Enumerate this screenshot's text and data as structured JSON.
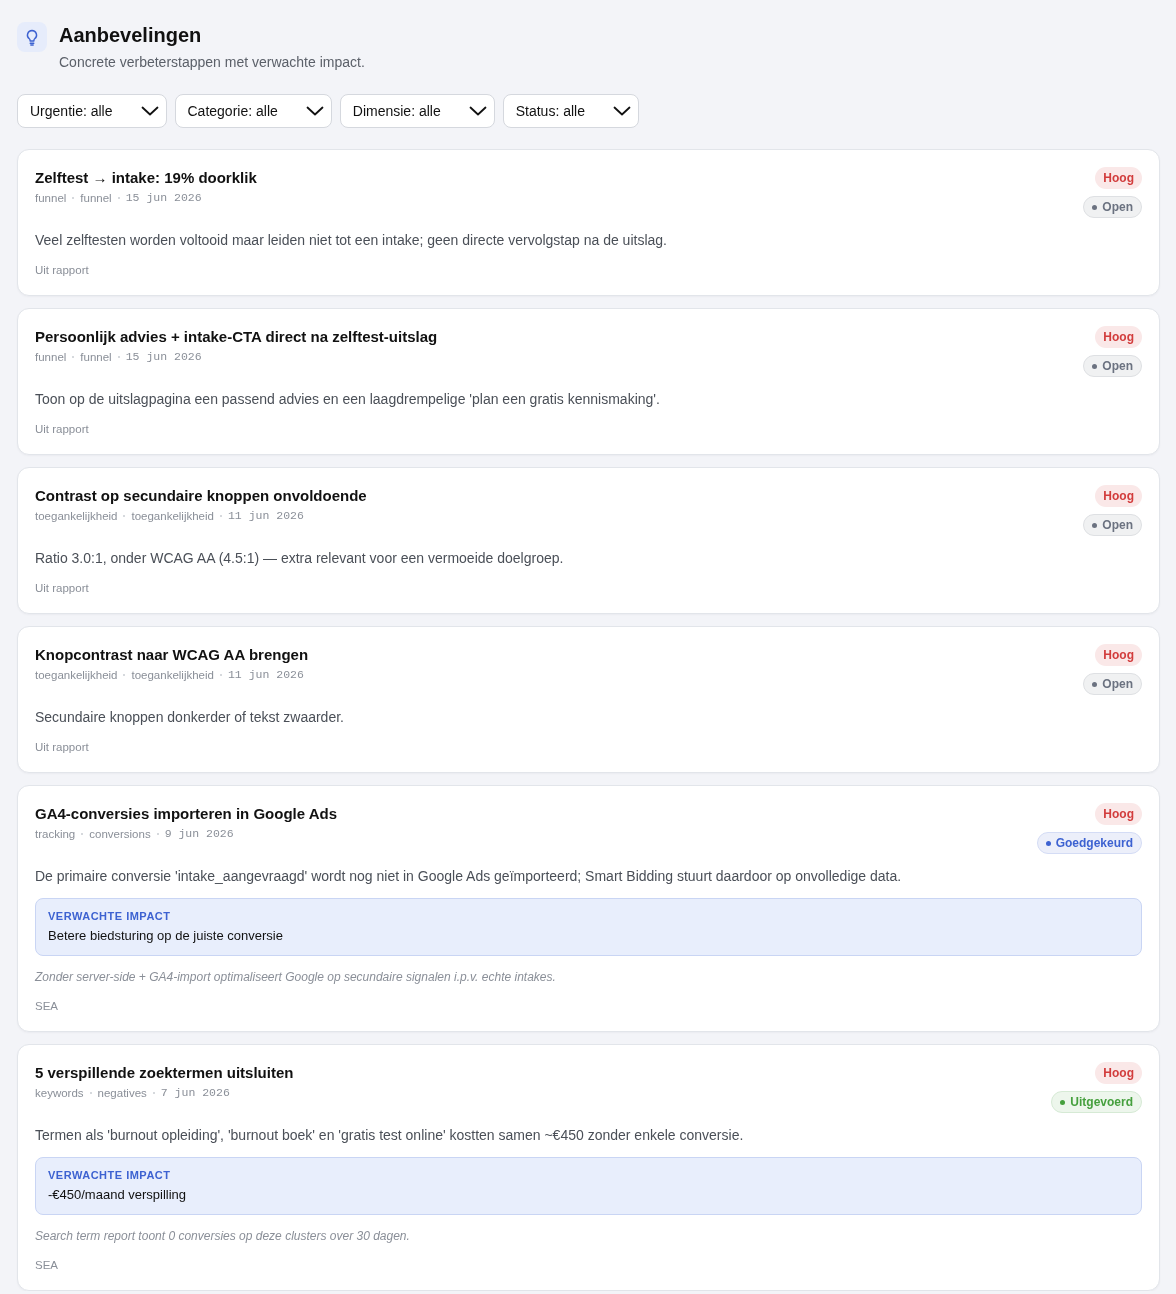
{
  "header": {
    "title": "Aanbevelingen",
    "subtitle": "Concrete verbeterstappen met verwachte impact."
  },
  "filters": [
    {
      "label": "Urgentie: alle"
    },
    {
      "label": "Categorie: alle"
    },
    {
      "label": "Dimensie: alle"
    },
    {
      "label": "Status: alle"
    }
  ],
  "cards": [
    {
      "title": "Zelftest → intake: 19% doorklik",
      "category": "funnel",
      "dimension": "funnel",
      "date": "15 jun 2026",
      "urgency": {
        "label": "Hoog",
        "color": "#d23c3c"
      },
      "status": {
        "label": "Open",
        "color": "#6b7280"
      },
      "description": "Veel zelftesten worden voltooid maar leiden niet tot een intake; geen directe vervolgstap na de uitslag.",
      "source": "Uit rapport"
    },
    {
      "title": "Persoonlijk advies + intake-CTA direct na zelftest-uitslag",
      "category": "funnel",
      "dimension": "funnel",
      "date": "15 jun 2026",
      "urgency": {
        "label": "Hoog",
        "color": "#d23c3c"
      },
      "status": {
        "label": "Open",
        "color": "#6b7280"
      },
      "description": "Toon op de uitslagpagina een passend advies en een laagdrempelige 'plan een gratis kennismaking'.",
      "source": "Uit rapport"
    },
    {
      "title": "Contrast op secundaire knoppen onvoldoende",
      "category": "toegankelijkheid",
      "dimension": "toegankelijkheid",
      "date": "11 jun 2026",
      "urgency": {
        "label": "Hoog",
        "color": "#d23c3c"
      },
      "status": {
        "label": "Open",
        "color": "#6b7280"
      },
      "description": "Ratio 3.0:1, onder WCAG AA (4.5:1) — extra relevant voor een vermoeide doelgroep.",
      "source": "Uit rapport"
    },
    {
      "title": "Knopcontrast naar WCAG AA brengen",
      "category": "toegankelijkheid",
      "dimension": "toegankelijkheid",
      "date": "11 jun 2026",
      "urgency": {
        "label": "Hoog",
        "color": "#d23c3c"
      },
      "status": {
        "label": "Open",
        "color": "#6b7280"
      },
      "description": "Secundaire knoppen donkerder of tekst zwaarder.",
      "source": "Uit rapport"
    },
    {
      "title": "GA4-conversies importeren in Google Ads",
      "category": "tracking",
      "dimension": "conversions",
      "date": "9 jun 2026",
      "urgency": {
        "label": "Hoog",
        "color": "#d23c3c"
      },
      "status": {
        "label": "Goedgekeurd",
        "color": "#3d62d1"
      },
      "description": "De primaire conversie 'intake_aangevraagd' wordt nog niet in Google Ads geïmporteerd; Smart Bidding stuurt daardoor op onvolledige data.",
      "impact": {
        "label": "VERWACHTE IMPACT",
        "value": "Betere biedsturing op de juiste conversie"
      },
      "note": "Zonder server-side + GA4-import optimaliseert Google op secundaire signalen i.p.v. echte intakes.",
      "source": "SEA"
    },
    {
      "title": "5 verspillende zoektermen uitsluiten",
      "category": "keywords",
      "dimension": "negatives",
      "date": "7 jun 2026",
      "urgency": {
        "label": "Hoog",
        "color": "#d23c3c"
      },
      "status": {
        "label": "Uitgevoerd",
        "color": "#46a03e"
      },
      "description": "Termen als 'burnout opleiding', 'burnout boek' en 'gratis test online' kostten samen ~€450 zonder enkele conversie.",
      "impact": {
        "label": "VERWACHTE IMPACT",
        "value": "-€450/maand verspilling"
      },
      "note": "Search term report toont 0 conversies op deze clusters over 30 dagen.",
      "source": "SEA"
    }
  ]
}
